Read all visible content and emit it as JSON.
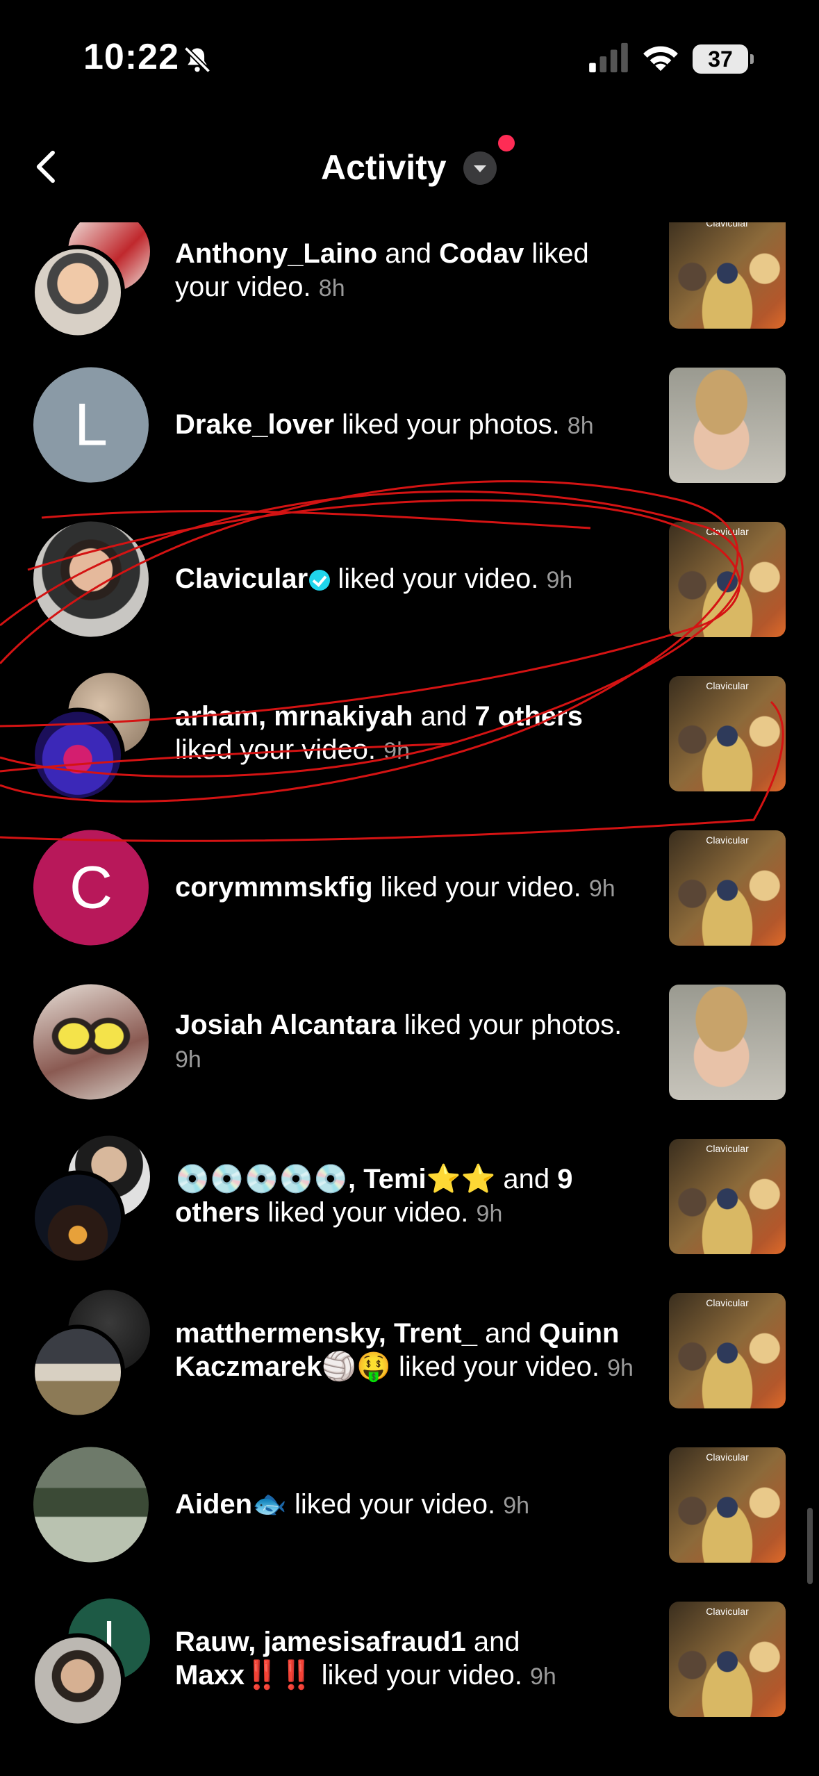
{
  "status_bar": {
    "time": "10:22",
    "battery": "37"
  },
  "header": {
    "title": "Activity"
  },
  "colors": {
    "background": "#000000",
    "accent": "#fe2c55",
    "verified": "#20d5ec",
    "muted": "#9a9a9a"
  },
  "thumbnail_caption": "Clavicular",
  "rows": [
    {
      "parts": [
        {
          "t": "Anthony_Laino",
          "b": 1
        },
        {
          "t": " and "
        },
        {
          "t": "Codav",
          "b": 1
        },
        {
          "t": " liked your video. "
        }
      ],
      "time": "8h",
      "thumb": "video"
    },
    {
      "parts": [
        {
          "t": "Drake_lover",
          "b": 1
        },
        {
          "t": " liked your photos. "
        }
      ],
      "time": "8h",
      "thumb": "photo",
      "letter": "L"
    },
    {
      "parts": [
        {
          "t": "Clavicular",
          "b": 1
        },
        {
          "t": " liked your video. "
        }
      ],
      "time": "9h",
      "thumb": "video",
      "verified": true
    },
    {
      "parts": [
        {
          "t": "arham, mrnakiyah",
          "b": 1
        },
        {
          "t": " and "
        },
        {
          "t": "7 others",
          "b": 1
        },
        {
          "t": " liked your video. "
        }
      ],
      "time": "9h",
      "thumb": "video"
    },
    {
      "parts": [
        {
          "t": "corymmmskfig",
          "b": 1
        },
        {
          "t": " liked your video. "
        }
      ],
      "time": "9h",
      "thumb": "video",
      "letter": "C"
    },
    {
      "parts": [
        {
          "t": "Josiah Alcantara",
          "b": 1
        },
        {
          "t": " liked your photos. "
        }
      ],
      "time": "9h",
      "thumb": "photo"
    },
    {
      "parts": [
        {
          "t": "💿💿💿💿💿, Temi⭐⭐",
          "b": 1
        },
        {
          "t": " and "
        },
        {
          "t": "9 others",
          "b": 1
        },
        {
          "t": " liked your video. "
        }
      ],
      "time": "9h",
      "thumb": "video"
    },
    {
      "parts": [
        {
          "t": "matthermensky, Trent_",
          "b": 1
        },
        {
          "t": " and "
        },
        {
          "t": "Quinn Kaczmarek🏐",
          "b": 1
        },
        {
          "t": "🤑 liked your video. "
        }
      ],
      "time": "9h",
      "thumb": "video"
    },
    {
      "parts": [
        {
          "t": "Aiden🐟",
          "b": 1
        },
        {
          "t": " liked your video. "
        }
      ],
      "time": "9h",
      "thumb": "video"
    },
    {
      "parts": [
        {
          "t": "Rauw, jamesisafraud1",
          "b": 1
        },
        {
          "t": " and "
        },
        {
          "t": "Maxx‼️‼️",
          "b": 1
        },
        {
          "t": " liked your video. "
        }
      ],
      "time": "9h",
      "thumb": "video",
      "letter": "l"
    }
  ]
}
